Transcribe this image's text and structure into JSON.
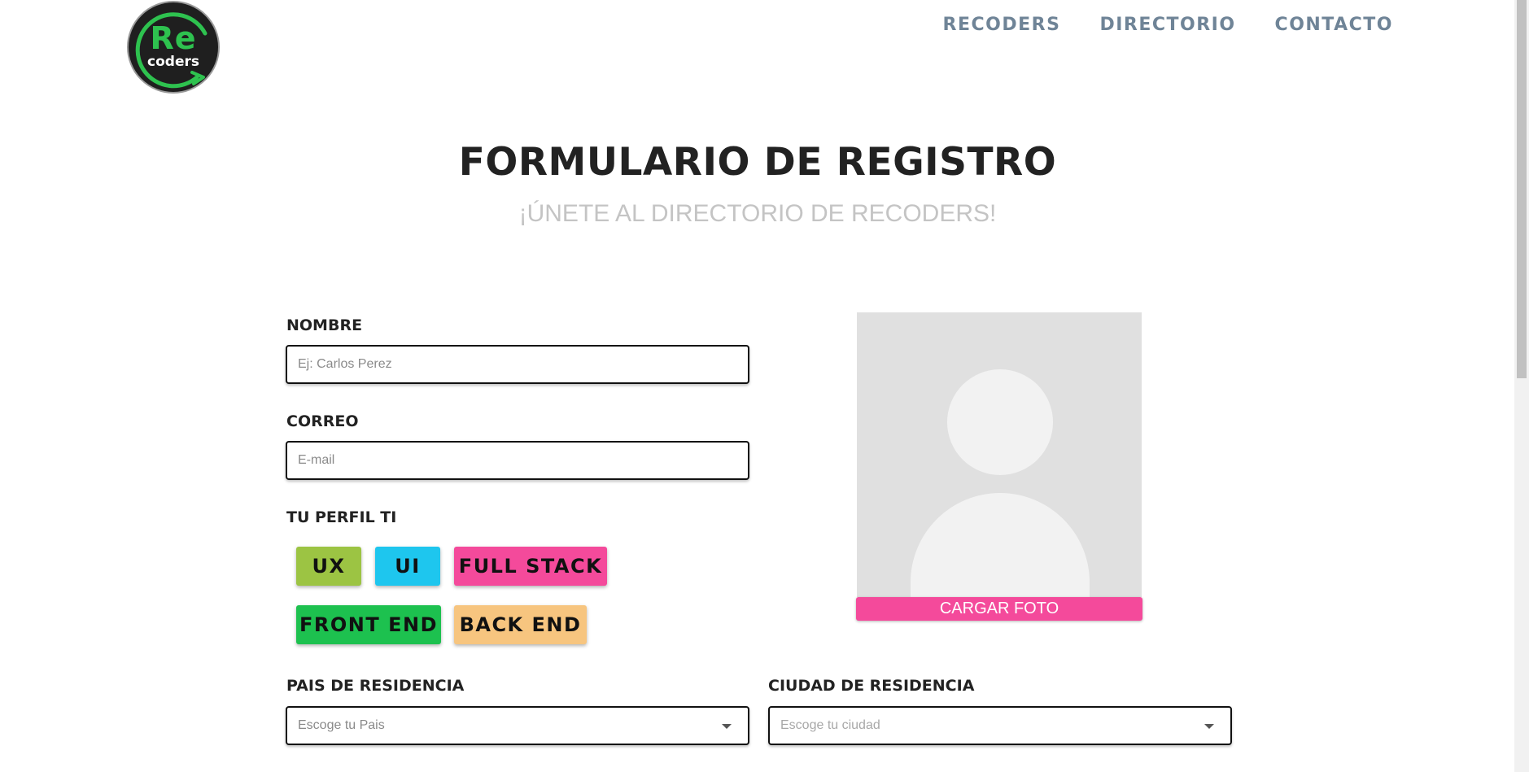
{
  "brand": {
    "logo_top": "Re",
    "logo_bottom": "coders",
    "logo_color": "#2ec24f"
  },
  "nav": {
    "items": [
      "RECODERS",
      "DIRECTORIO",
      "CONTACTO"
    ]
  },
  "page": {
    "title": "FORMULARIO DE REGISTRO",
    "subtitle": "¡ÚNETE AL DIRECTORIO DE RECODERS!"
  },
  "form": {
    "name": {
      "label": "NOMBRE",
      "placeholder": "Ej: Carlos Perez",
      "value": ""
    },
    "email": {
      "label": "CORREO",
      "placeholder": "E-mail",
      "value": ""
    },
    "profile": {
      "label": "TU PERFIL TI",
      "options": [
        {
          "label": "UX",
          "color": "#9cc443"
        },
        {
          "label": "UI",
          "color": "#1ec6ee"
        },
        {
          "label": "FULL STACK",
          "color": "#f44a9b"
        },
        {
          "label": "FRONT END",
          "color": "#1dc14f"
        },
        {
          "label": "BACK END",
          "color": "#f7c57f"
        }
      ]
    },
    "country": {
      "label": "PAIS DE RESIDENCIA",
      "placeholder": "Escoge tu Pais"
    },
    "city": {
      "label": "CIUDAD DE RESIDENCIA",
      "placeholder": "Escoge tu ciudad"
    }
  },
  "photo": {
    "upload_label": "CARGAR FOTO",
    "upload_color": "#f44a9b"
  }
}
